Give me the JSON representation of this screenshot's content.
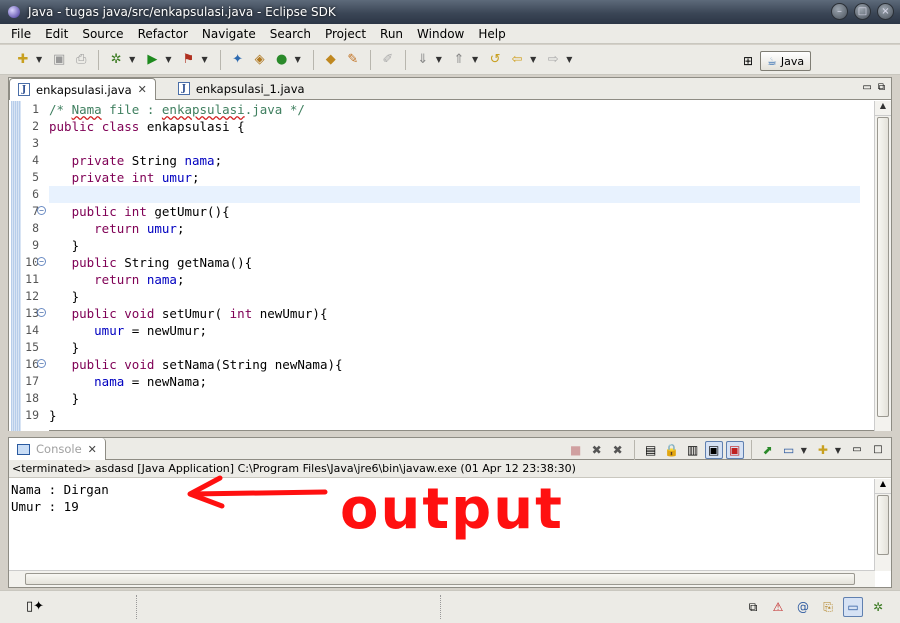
{
  "window": {
    "title": "Java - tugas java/src/enkapsulasi.java - Eclipse SDK"
  },
  "menu": [
    "File",
    "Edit",
    "Source",
    "Refactor",
    "Navigate",
    "Search",
    "Project",
    "Run",
    "Window",
    "Help"
  ],
  "perspective": {
    "label": "Java"
  },
  "editor": {
    "tabs": [
      {
        "label": "enkapsulasi.java",
        "active": true
      },
      {
        "label": "enkapsulasi_1.java",
        "active": false
      }
    ]
  },
  "console": {
    "tab_label": "Console",
    "status": "<terminated> asdasd [Java Application] C:\\Program Files\\Java\\jre6\\bin\\javaw.exe (01 Apr 12 23:38:30)",
    "output": [
      "Nama : Dirgan",
      "Umur : 19"
    ]
  },
  "annotation": {
    "text": "output",
    "color": "#ff1010"
  },
  "colors": {
    "keyword": "#7f0055",
    "comment": "#3f7f5f",
    "field": "#0000c0",
    "current_line": "#e8f2fe"
  }
}
